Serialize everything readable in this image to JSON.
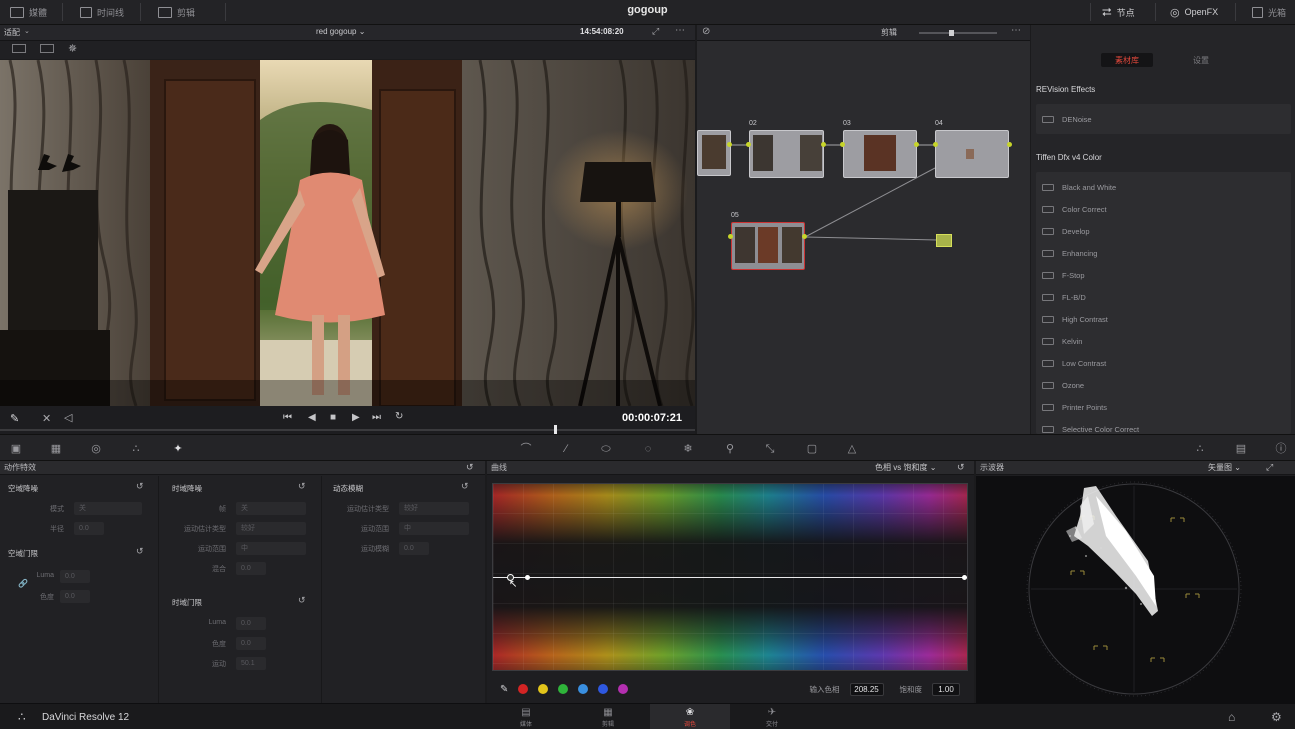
{
  "topbar": {
    "media_label": "媒體",
    "timeline_label": "时间线",
    "edit_label": "剪辑",
    "title": "gogoup",
    "nodes_label": "节点",
    "openfx_label": "OpenFX",
    "library_label": "光箱"
  },
  "viewer": {
    "zoom_label": "适配",
    "clip_name": "red gogoup",
    "source_timecode": "14:54:08:20",
    "timecode": "00:00:07:21"
  },
  "node_editor": {
    "mode_label": "剪辑",
    "nodes": [
      {
        "id": "node-01",
        "label": ""
      },
      {
        "id": "node-02",
        "label": "02"
      },
      {
        "id": "node-03",
        "label": "03"
      },
      {
        "id": "node-04",
        "label": "04"
      },
      {
        "id": "node-05",
        "label": "05"
      }
    ]
  },
  "library": {
    "tab_active": "素材库",
    "tab_settings": "设置",
    "section1": "REVision Effects",
    "section1_items": [
      "DENoise"
    ],
    "section2": "Tiffen Dfx v4 Color",
    "section2_items": [
      "Black and White",
      "Color Correct",
      "Develop",
      "Enhancing",
      "F-Stop",
      "FL-B/D",
      "High Contrast",
      "Kelvin",
      "Low Contrast",
      "Ozone",
      "Printer Points",
      "Selective Color Correct"
    ]
  },
  "motion": {
    "header": "动作特效",
    "spatial_nr_title": "空域降噪",
    "spatial_mode_label": "模式",
    "spatial_mode_value": "关",
    "spatial_radius_label": "半径",
    "spatial_radius_value": "0.0",
    "spatial_threshold_title": "空域门限",
    "spatial_luma_label": "Luma",
    "spatial_luma_value": "0.0",
    "spatial_chroma_label": "色度",
    "spatial_chroma_value": "0.0",
    "temporal_nr_title": "时域降噪",
    "temporal_frames_label": "帧",
    "temporal_frames_value": "关",
    "temporal_motion_type_label": "运动估计类型",
    "temporal_motion_type_value": "较好",
    "temporal_range_label": "运动范围",
    "temporal_range_value": "中",
    "temporal_blend_label": "混合",
    "temporal_blend_value": "0.0",
    "temporal_threshold_title": "时域门限",
    "temporal_luma_label": "Luma",
    "temporal_luma_value": "0.0",
    "temporal_chroma_label": "色度",
    "temporal_chroma_value": "0.0",
    "temporal_motion_label": "运动",
    "temporal_motion_value": "50.1",
    "motion_blur_title": "动态模糊",
    "mb_type_label": "运动估计类型",
    "mb_type_value": "较好",
    "mb_range_label": "运动范围",
    "mb_range_value": "中",
    "mb_amount_label": "运动模糊",
    "mb_amount_value": "0.0"
  },
  "curves": {
    "header": "曲线",
    "mode": "色相 vs 饱和度",
    "input_hue_label": "输入色相",
    "input_hue_value": "208.25",
    "saturation_label": "饱和度",
    "saturation_value": "1.00",
    "swatch_colors": [
      "#d32424",
      "#e3c51b",
      "#2fb43a",
      "#3a8fe0",
      "#2e58e0",
      "#b42fb0"
    ]
  },
  "scope": {
    "header": "示波器",
    "mode": "矢量图"
  },
  "status": {
    "app_name": "DaVinci Resolve 12",
    "pages": [
      "媒体",
      "剪辑",
      "调色",
      "交付"
    ]
  }
}
